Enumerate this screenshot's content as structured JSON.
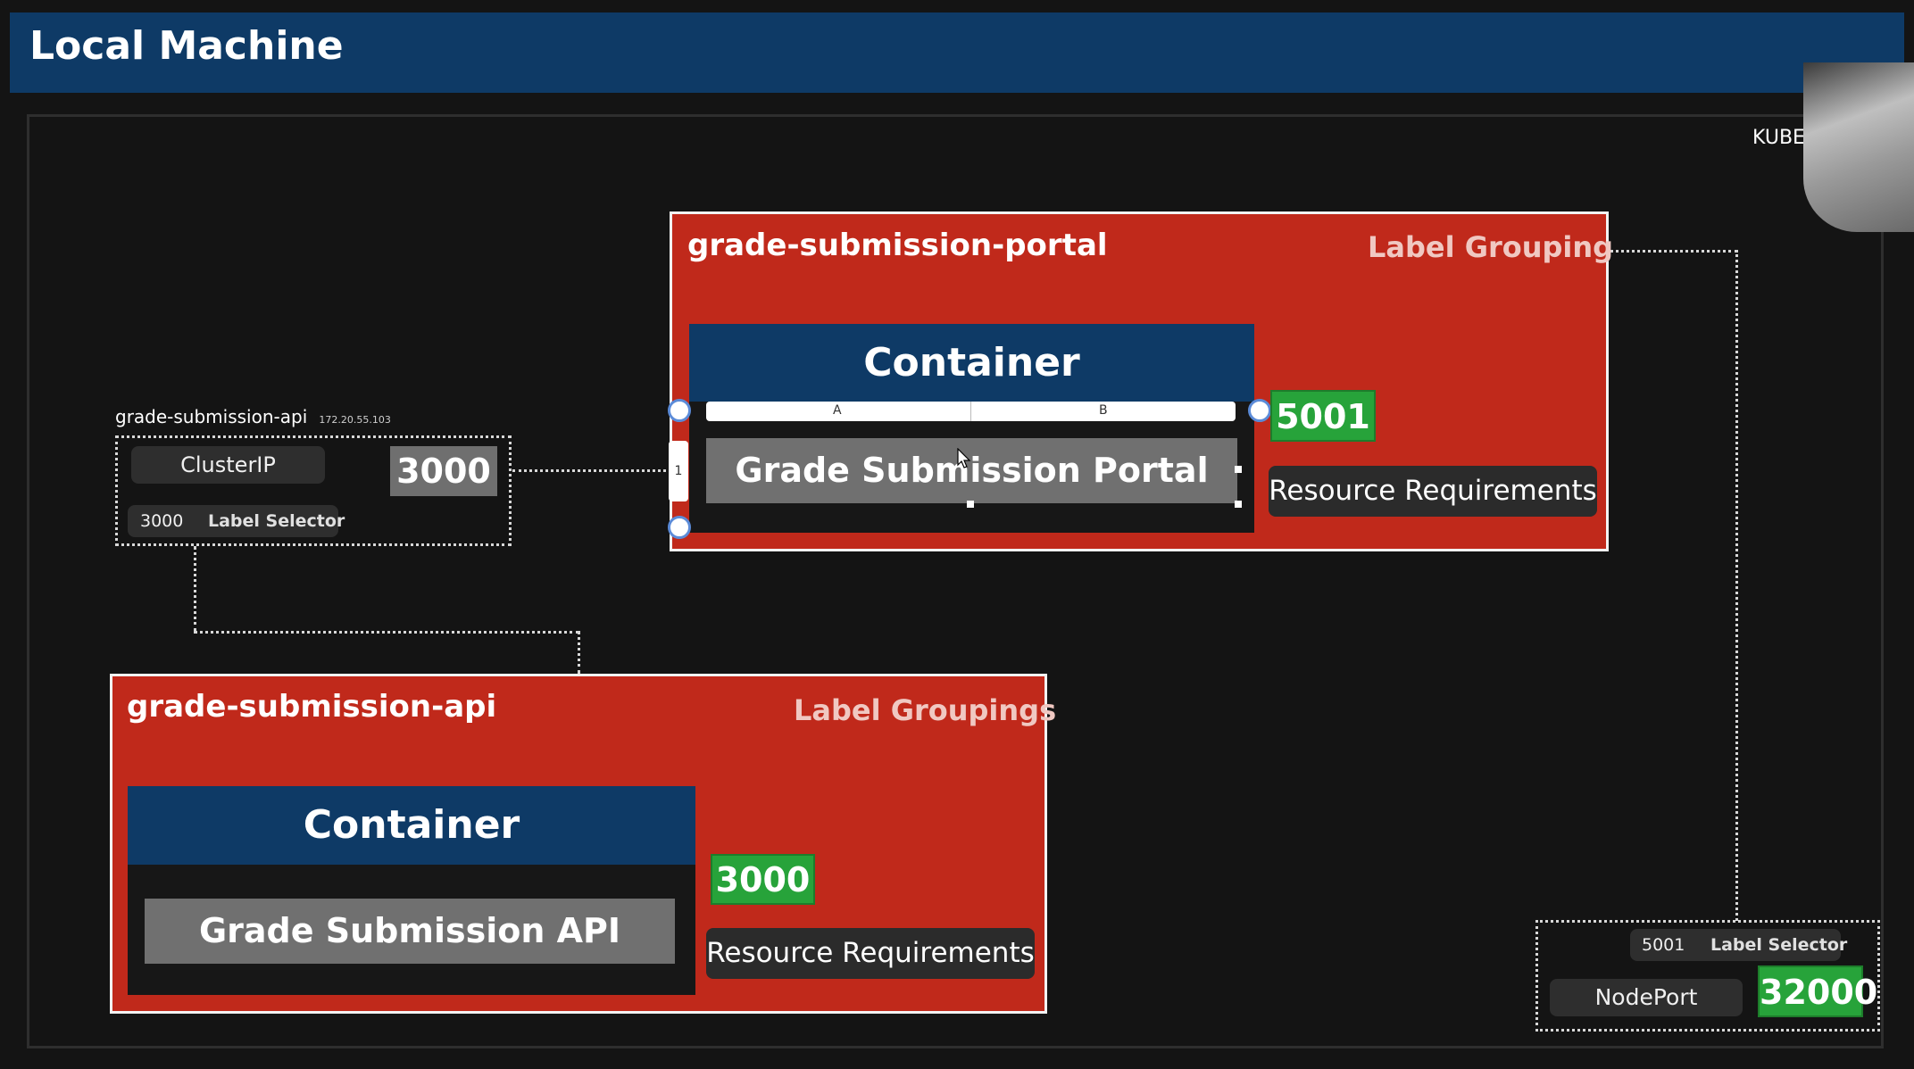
{
  "slide": {
    "title": "Local Machine",
    "corner_label": "KUBERN"
  },
  "api_service": {
    "name": "grade-submission-api",
    "ip": "172.20.55.103",
    "type": "ClusterIP",
    "port": "3000",
    "selector_port": "3000",
    "selector_label": "Label Selector"
  },
  "portal_deployment": {
    "name": "grade-submission-portal",
    "group_label": "Label Grouping",
    "container_title": "Container",
    "app_name": "Grade Submission Portal",
    "port": "5001",
    "resources": "Resource Requirements",
    "ruler": {
      "col_a": "A",
      "col_b": "B",
      "row_1": "1"
    }
  },
  "api_deployment": {
    "name": "grade-submission-api",
    "group_label": "Label Groupings",
    "container_title": "Container",
    "app_name": "Grade Submission API",
    "port": "3000",
    "resources": "Resource Requirements"
  },
  "portal_service": {
    "selector_port": "5001",
    "selector_label": "Label Selector",
    "type": "NodePort",
    "node_port": "32000"
  },
  "colors": {
    "title_bar": "#0e3a66",
    "deployment_fill": "#c0291b",
    "container_header": "#0e3a66",
    "port_green": "#27a33a",
    "background": "#141414"
  }
}
